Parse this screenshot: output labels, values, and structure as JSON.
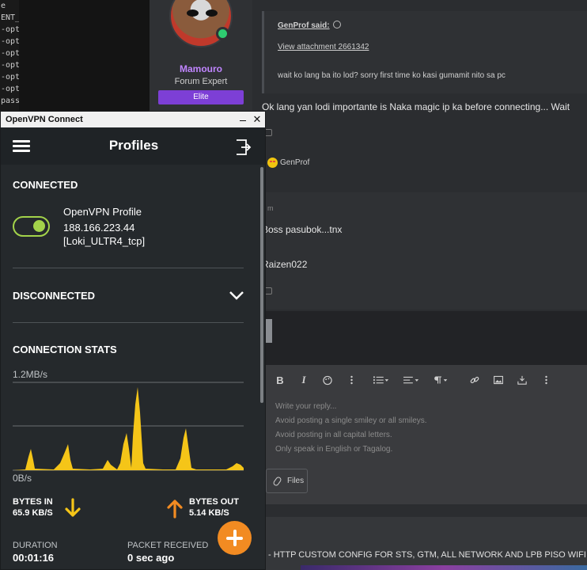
{
  "background": {
    "terminal_lines": [
      "e",
      "ENT_",
      "-opt",
      "-opt",
      "-opt",
      "-opt",
      "-opt",
      "-opt",
      "pass"
    ],
    "user": {
      "name": "Mamouro",
      "title": "Forum Expert",
      "badge": "Elite"
    },
    "quote": {
      "author": "GenProf said:",
      "attachment_link": "View attachment 2661342",
      "text": "wait ko lang ba ito lod? sorry first time ko kasi gumamit nito sa pc"
    },
    "post1_text": "Ok lang yan lodi importante is Naka magic ip ka before connecting... Wait",
    "reaction_user": "GenProf",
    "post2": {
      "time_fragment": "m",
      "text": "Boss pasubok...tnx",
      "signature": "Raizen022"
    },
    "editor": {
      "placeholder_lines": [
        "Write your reply...",
        "Avoid posting a single smiley or all smileys.",
        "Avoid posting in all capital letters.",
        "Only speak in English or Tagalog."
      ],
      "files_label": "Files"
    },
    "bottom_text": "- HTTP CUSTOM CONFIG FOR STS, GTM, ALL NETWORK AND LPB PISO WIFI M"
  },
  "vpn": {
    "window_title": "OpenVPN Connect",
    "header_title": "Profiles",
    "accent_green": "#a3d34a",
    "accent_orange": "#f28b22",
    "chart_yellow": "#f5c518",
    "connected": {
      "label": "CONNECTED",
      "profile_name": "OpenVPN Profile",
      "ip": "188.166.223.44",
      "server": "[Loki_ULTR4_tcp]"
    },
    "disconnected_label": "DISCONNECTED",
    "stats": {
      "label": "CONNECTION STATS",
      "max_rate": "1.2MB/s",
      "min_rate": "0B/s",
      "bytes_in_label": "BYTES IN",
      "bytes_in_value": "65.9 KB/S",
      "bytes_out_label": "BYTES OUT",
      "bytes_out_value": "5.14 KB/S",
      "duration_label": "DURATION",
      "duration_value": "00:01:16",
      "packet_label": "PACKET RECEIVED",
      "packet_value": "0 sec ago"
    }
  }
}
